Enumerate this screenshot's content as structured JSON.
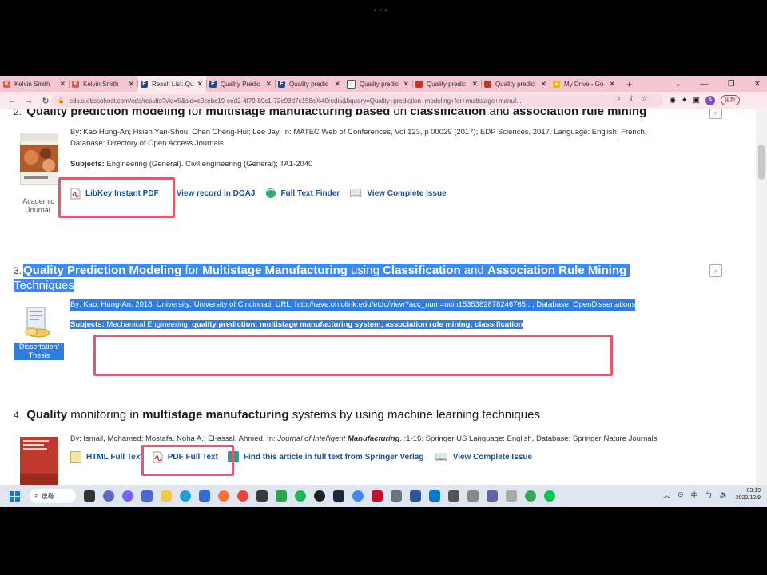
{
  "browser": {
    "tabs": [
      {
        "label": "Kelvin Smith",
        "icon_color": "#e05a4e",
        "active": false
      },
      {
        "label": "Kelvin Smith",
        "icon_color": "#e05a4e",
        "active": false
      },
      {
        "label": "Result List: Qu",
        "icon_color": "#1f4e8c",
        "active": true
      },
      {
        "label": "Quality Predic",
        "icon_color": "#1f4e8c",
        "active": false
      },
      {
        "label": "Quality predic",
        "icon_color": "#1f4e8c",
        "active": false
      },
      {
        "label": "Quality predic",
        "icon_color": "#555555",
        "active": false
      },
      {
        "label": "Quality predic",
        "icon_color": "#c0392b",
        "active": false
      },
      {
        "label": "Quality predic",
        "icon_color": "#c0392b",
        "active": false
      },
      {
        "label": "My Drive - Go",
        "icon_color": "#f4b400",
        "active": false
      }
    ],
    "url": "eds.s.ebscohost.com/eds/results?vid=5&sid=c0cebc19-eed2-4f79-89c1-72e93d7c158c%40redis&bquery=Quality+prediction+modeling+for+multistage+manuf...",
    "avatar_letter": "A",
    "update_label": "更新"
  },
  "results": {
    "r2": {
      "number": "2.",
      "title_parts": [
        "Quality prediction modeling",
        " for ",
        "multistage manufacturing based",
        " on ",
        "classification",
        " and ",
        "association rule mining"
      ],
      "meta_line1": "By: Kao Hung-An; Hsieh Yan-Shou; Chen Cheng-Hui; Lee Jay. In: MATEC Web of Conferences, Vol 123, p 00029 (2017); EDP Sciences, 2017. Language: English; French,",
      "meta_line2": "Database: Directory of Open Access Journals",
      "subjects_label": "Subjects:",
      "subjects": " Engineering (General). Civil engineering (General); TA1-2040",
      "type_line1": "Academic",
      "type_line2": "Journal",
      "links": [
        "LibKey Instant PDF",
        "View record in DOAJ",
        "Full Text Finder",
        "View Complete Issue"
      ]
    },
    "r3": {
      "number": "3.",
      "title_parts": [
        "Quality Prediction Modeling",
        " for ",
        "Multistage Manufacturing",
        " using ",
        "Classification",
        " and ",
        "Association Rule Mining"
      ],
      "title_line2": "Techniques",
      "meta_line1": "By: Kao, Hung-An. 2018. University: University of Cincinnati. URL: http://rave.ohiolink.edu/etdc/view?acc_num=ucin1535382878246765 . , Database: OpenDissertations",
      "subjects_label": "Subjects:",
      "subjects_plain": " Mechanical Engineering; ",
      "subjects_bold": "quality prediction; multistage manufacturing system; association rule mining; classification",
      "type_line1": "Dissertation/",
      "type_line2": "Thesis"
    },
    "r4": {
      "number": "4.",
      "title_parts": [
        "Quality",
        " monitoring in ",
        "multistage manufacturing",
        " systems by using machine learning techniques"
      ],
      "meta_prefix": "By: Ismail, Mohamed; Mostafa, Noha A.; El-assal, Ahmed. In: ",
      "meta_journal_a": "Journal of Intelligent ",
      "meta_journal_b": "Manufacturing",
      "meta_suffix": ". :1-16; Springer US Language: English, Database: Springer Nature Journals",
      "links": [
        "HTML Full Text",
        "PDF Full Text",
        "Find this article in full text from Springer Verlag",
        "View Complete Issue"
      ]
    }
  },
  "taskbar": {
    "search_label": "搜尋",
    "ime": "中",
    "time": "03:19",
    "date": "2022/12/9"
  }
}
